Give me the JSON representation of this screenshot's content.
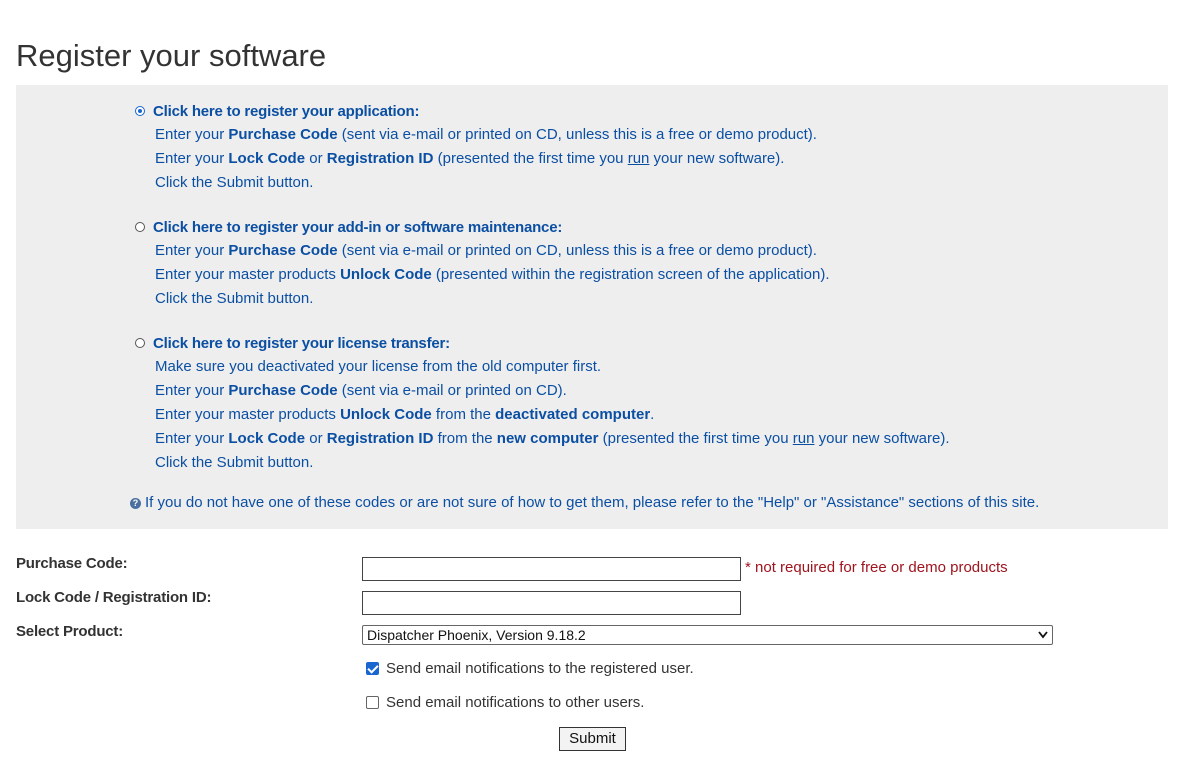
{
  "page": {
    "title": "Register your software"
  },
  "options": [
    {
      "label": "Click here to register your application:",
      "selected": true,
      "lines": [
        [
          {
            "t": "Enter your "
          },
          {
            "t": "Purchase Code",
            "b": true
          },
          {
            "t": " (sent via e-mail or printed on CD, unless this is a free or demo product)."
          }
        ],
        [
          {
            "t": "Enter your "
          },
          {
            "t": "Lock Code",
            "b": true
          },
          {
            "t": " or "
          },
          {
            "t": "Registration ID",
            "b": true
          },
          {
            "t": " (presented the first time you "
          },
          {
            "t": "run",
            "u": true
          },
          {
            "t": " your new software)."
          }
        ],
        [
          {
            "t": "Click the Submit button."
          }
        ]
      ]
    },
    {
      "label": "Click here to register your add-in or software maintenance:",
      "selected": false,
      "lines": [
        [
          {
            "t": "Enter your "
          },
          {
            "t": "Purchase Code",
            "b": true
          },
          {
            "t": " (sent via e-mail or printed on CD, unless this is a free or demo product)."
          }
        ],
        [
          {
            "t": "Enter your master products "
          },
          {
            "t": "Unlock Code",
            "b": true
          },
          {
            "t": " (presented within the registration screen of the application)."
          }
        ],
        [
          {
            "t": "Click the Submit button."
          }
        ]
      ]
    },
    {
      "label": "Click here to register your license transfer:",
      "selected": false,
      "lines": [
        [
          {
            "t": "Make sure you deactivated your license from the old computer first."
          }
        ],
        [
          {
            "t": "Enter your "
          },
          {
            "t": "Purchase Code",
            "b": true
          },
          {
            "t": " (sent via e-mail or printed on CD)."
          }
        ],
        [
          {
            "t": "Enter your master products "
          },
          {
            "t": "Unlock Code",
            "b": true
          },
          {
            "t": " from the "
          },
          {
            "t": "deactivated computer",
            "b": true
          },
          {
            "t": "."
          }
        ],
        [
          {
            "t": "Enter your "
          },
          {
            "t": "Lock Code",
            "b": true
          },
          {
            "t": " or "
          },
          {
            "t": "Registration ID",
            "b": true
          },
          {
            "t": " from the "
          },
          {
            "t": "new computer",
            "b": true
          },
          {
            "t": " (presented the first time you "
          },
          {
            "t": "run",
            "u": true
          },
          {
            "t": " your new software)."
          }
        ],
        [
          {
            "t": "Click the Submit button."
          }
        ]
      ]
    }
  ],
  "help": {
    "icon": "question-circle-icon",
    "text": "If you do not have one of these codes or are not sure of how to get them, please refer to the \"Help\" or \"Assistance\" sections of this site."
  },
  "form": {
    "purchase_code_label": "Purchase Code:",
    "purchase_code_value": "",
    "purchase_code_note": "* not required for free or demo products",
    "lock_code_label": "Lock Code / Registration ID:",
    "lock_code_value": "",
    "product_label": "Select Product:",
    "product_selected": "Dispatcher Phoenix, Version 9.18.2",
    "notify_registered_label": "Send email notifications to the registered user.",
    "notify_registered_checked": true,
    "notify_others_label": "Send email notifications to other users.",
    "notify_others_checked": false,
    "submit_label": "Submit"
  },
  "colors": {
    "link_blue": "#0b4fa3",
    "panel_bg": "#eeeeee",
    "note_red": "#a0141e",
    "accent": "#1a66d0"
  }
}
